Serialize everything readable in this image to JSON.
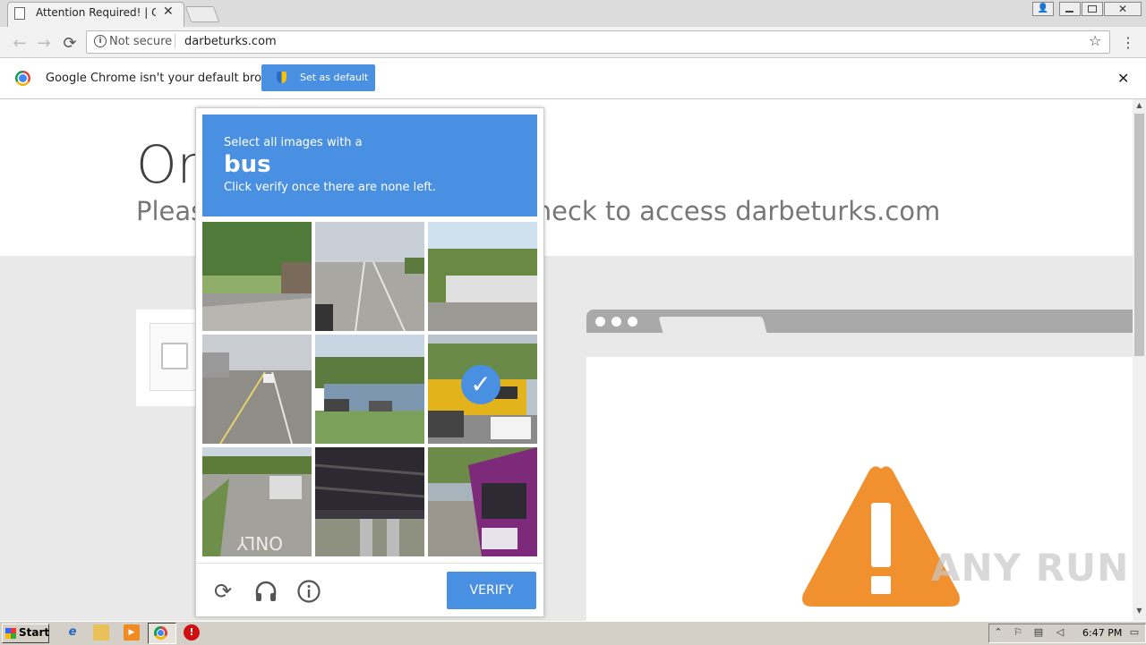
{
  "browser": {
    "tab_title": "Attention Required! | Cloudf",
    "tab_close": "✕",
    "security_label": "Not secure",
    "url": "darbeturks.com"
  },
  "infobar": {
    "message": "Google Chrome isn't your default browser",
    "button_label": "Set as default",
    "close": "✕"
  },
  "page": {
    "headline": "One",
    "subline": "Please complete the security check to access darbeturks.com"
  },
  "captcha": {
    "instruction_pre": "Select all images with a",
    "target_word": "bus",
    "instruction_post": "Click verify once there are none left.",
    "tiles": [
      {
        "selected": false
      },
      {
        "selected": false
      },
      {
        "selected": false
      },
      {
        "selected": false
      },
      {
        "selected": false
      },
      {
        "selected": true
      },
      {
        "selected": false
      },
      {
        "selected": false
      },
      {
        "selected": false
      }
    ],
    "verify_label": "VERIFY"
  },
  "watermark": "ANY RUN",
  "taskbar": {
    "start_label": "Start",
    "clock": "6:47 PM"
  },
  "colors": {
    "accent_blue": "#4a90e2",
    "warning_orange": "#f0902e"
  }
}
